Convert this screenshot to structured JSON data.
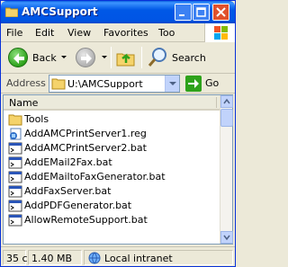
{
  "window": {
    "title": "AMCSupport"
  },
  "menu": {
    "items": [
      "File",
      "Edit",
      "View",
      "Favorites",
      "Too"
    ]
  },
  "toolbar": {
    "back_label": "Back",
    "search_label": "Search"
  },
  "address": {
    "label": "Address",
    "path": "U:\\AMCSupport",
    "go_label": "Go"
  },
  "list": {
    "column_name": "Name",
    "items": [
      {
        "name": "Tools",
        "icon": "folder-icon"
      },
      {
        "name": "AddAMCPrintServer1.reg",
        "icon": "registry-file-icon"
      },
      {
        "name": "AddAMCPrintServer2.bat",
        "icon": "batch-file-icon"
      },
      {
        "name": "AddEMail2Fax.bat",
        "icon": "batch-file-icon"
      },
      {
        "name": "AddEMailtoFaxGenerator.bat",
        "icon": "batch-file-icon"
      },
      {
        "name": "AddFaxServer.bat",
        "icon": "batch-file-icon"
      },
      {
        "name": "AddPDFGenerator.bat",
        "icon": "batch-file-icon"
      },
      {
        "name": "AllowRemoteSupport.bat",
        "icon": "batch-file-icon"
      }
    ]
  },
  "status": {
    "objects": "35 c",
    "size": "1.40 MB",
    "zone": "Local intranet"
  },
  "colors": {
    "titlebar": "#0058e6",
    "window_bg": "#ece9d8",
    "accent_green": "#2ea21b"
  }
}
